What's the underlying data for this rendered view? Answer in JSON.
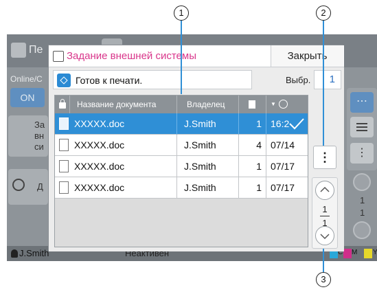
{
  "background": {
    "title_fragment": "Пе",
    "online_fragment": "Online/C",
    "on_label": "ON",
    "item_fragment_1": "За",
    "item_fragment_2": "вн",
    "item_fragment_3": "си",
    "search_fragment": "Д",
    "user": "J.Smith",
    "status_inactive": "Неактивен",
    "page_fraction_top": "1",
    "page_fraction_bottom": "1",
    "toner_c": "C",
    "toner_m": "M",
    "toner_y": "Y"
  },
  "dialog": {
    "title": "Задание внешней системы",
    "close_label": "Закрыть",
    "status_text": "Готов к печати.",
    "selected_label": "Выбр.",
    "selected_count": "1"
  },
  "table": {
    "columns": {
      "name": "Название документа",
      "owner": "Владелец"
    },
    "rows": [
      {
        "name": "XXXXX.doc",
        "owner": "J.Smith",
        "copies": "1",
        "time": "16:2",
        "selected": true
      },
      {
        "name": "XXXXX.doc",
        "owner": "J.Smith",
        "copies": "4",
        "time": "07/14",
        "selected": false
      },
      {
        "name": "XXXXX.doc",
        "owner": "J.Smith",
        "copies": "1",
        "time": "07/17",
        "selected": false
      },
      {
        "name": "XXXXX.doc",
        "owner": "J.Smith",
        "copies": "1",
        "time": "07/17",
        "selected": false
      }
    ]
  },
  "pager": {
    "current": "1",
    "total": "1"
  },
  "callouts": {
    "one": "1",
    "two": "2",
    "three": "3"
  },
  "colors": {
    "accent": "#2f8fd6",
    "title_pink": "#d9368b"
  },
  "icons": [
    "job-icon",
    "status-icon",
    "lock-icon",
    "copies-icon",
    "clock-icon",
    "document-icon",
    "check-icon",
    "more-icon",
    "scroll-up-icon",
    "scroll-down-icon",
    "user-icon",
    "search-icon",
    "grid-icon",
    "list-icon"
  ]
}
